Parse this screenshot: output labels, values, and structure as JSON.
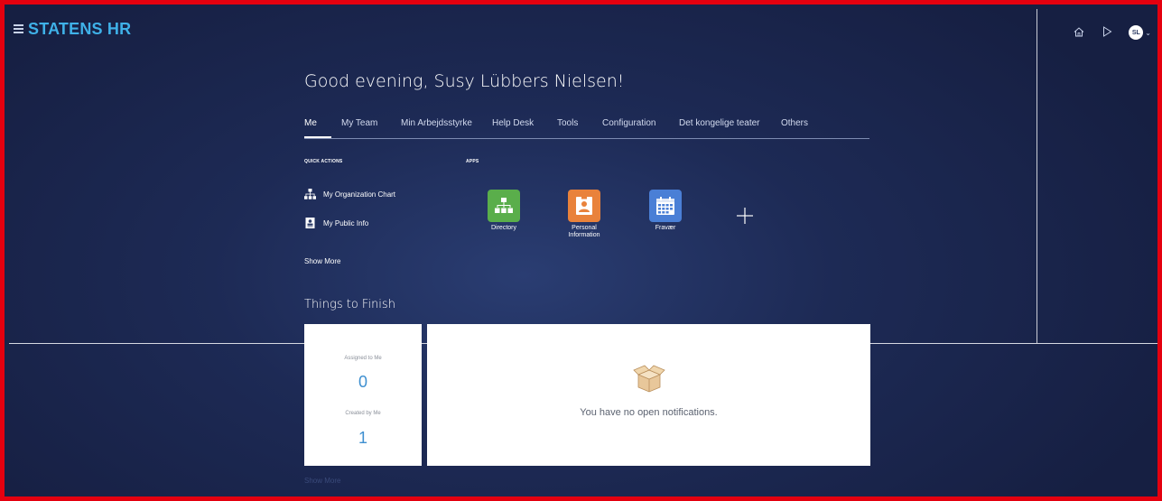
{
  "app": {
    "brand": "STATENS HR",
    "avatar_initials": "SL"
  },
  "icons": {
    "menu": "hamburger-menu-icon",
    "home": "home-icon",
    "play": "play-icon",
    "user_menu_caret": "chevron-down-icon"
  },
  "greeting": "Good evening, Susy Lübbers Nielsen!",
  "tabs": [
    {
      "label": "Me",
      "active": true
    },
    {
      "label": "My Team",
      "active": false
    },
    {
      "label": "Min Arbejdsstyrke",
      "active": false
    },
    {
      "label": "Help Desk",
      "active": false
    },
    {
      "label": "Tools",
      "active": false
    },
    {
      "label": "Configuration",
      "active": false
    },
    {
      "label": "Det kongelige teater",
      "active": false
    },
    {
      "label": "Others",
      "active": false
    }
  ],
  "quick_actions": {
    "heading": "QUICK ACTIONS",
    "items": [
      {
        "label": "My Organization Chart",
        "icon": "org-chart-icon"
      },
      {
        "label": "My Public Info",
        "icon": "id-badge-icon"
      }
    ],
    "show_more": "Show More"
  },
  "apps": {
    "heading": "APPS",
    "items": [
      {
        "label": "Directory",
        "icon": "directory-icon",
        "color": "#5aae4b"
      },
      {
        "label": "Personal Information",
        "icon": "personal-information-icon",
        "color": "#e9823b"
      },
      {
        "label": "Fravær",
        "icon": "calendar-icon",
        "color": "#4a7fd6"
      }
    ],
    "add_icon": "plus-icon"
  },
  "things_to_finish": {
    "title": "Things to Finish",
    "assigned_label": "Assigned to Me",
    "assigned_count": "0",
    "created_label": "Created by Me",
    "created_count": "1",
    "empty_message": "You have no open notifications.",
    "empty_icon": "open-box-icon",
    "show_more": "Show More"
  },
  "colors": {
    "frame_border": "#e4000f",
    "brand": "#3fb1e8",
    "background": "#1d2a55",
    "count_link": "#3e8fd0"
  }
}
